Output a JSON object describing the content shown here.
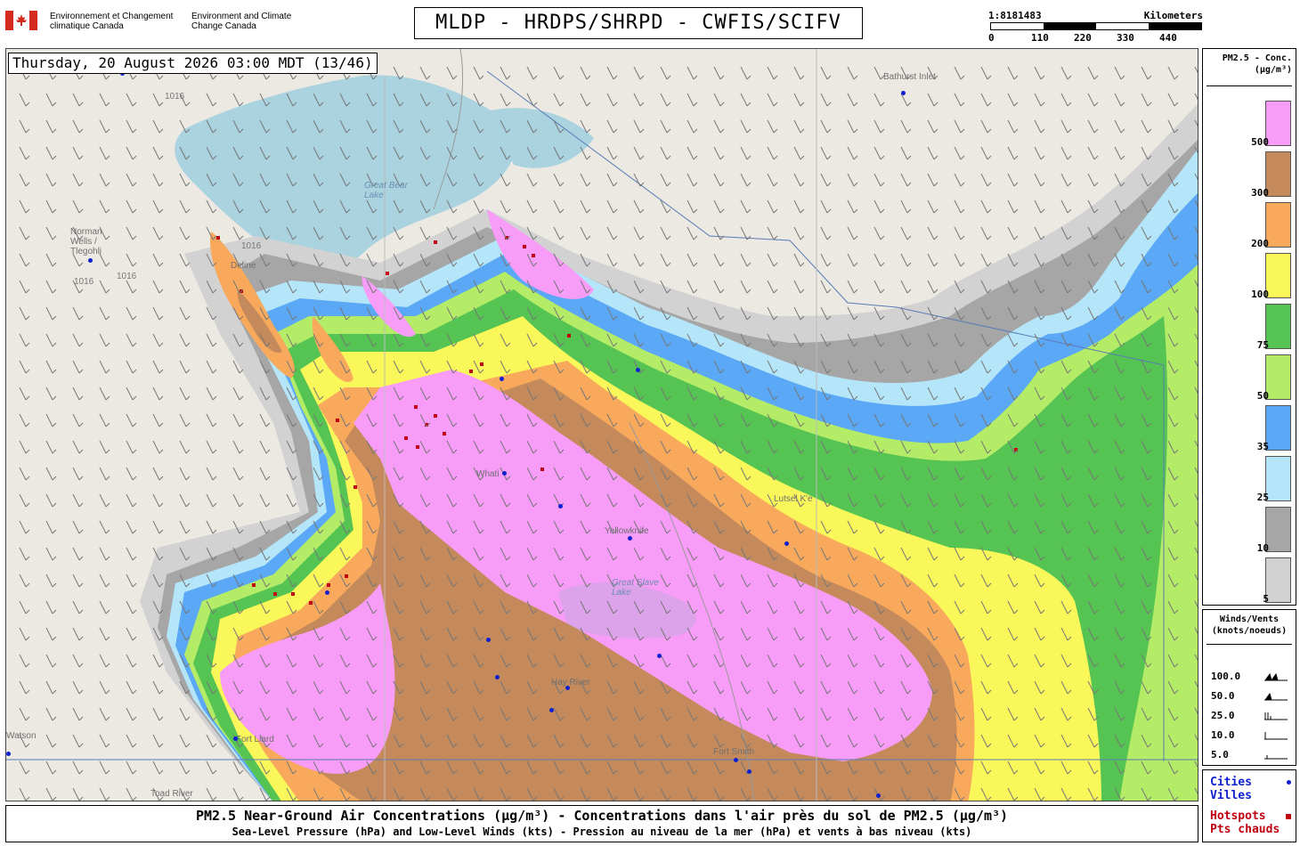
{
  "header": {
    "agency_fr": "Environnement et Changement climatique Canada",
    "agency_en": "Environment and Climate Change Canada",
    "title": "MLDP - HRDPS/SHRPD - CWFIS/SCIFV",
    "flag_color": "#d52b1e"
  },
  "scale": {
    "ratio": "1:8181483",
    "unit": "Kilometers",
    "ticks": [
      "0",
      "110",
      "220",
      "330",
      "440"
    ]
  },
  "map": {
    "timestamp": "Thursday, 20 August 2026 03:00 MDT (13/46)",
    "places": {
      "bathurst": "Bathurst Inlet",
      "great_bear": "Great Bear Lake",
      "norman_wells": "Norman Wells / Tlegohli",
      "deline": "Deline",
      "whati": "Whati",
      "yellowknife": "Yellowknife",
      "great_slave": "Great Slave Lake",
      "lutselke": "Lutsel K'e",
      "hay_river": "Hay River",
      "fort_liard": "Fort Liard",
      "fort_smith": "Fort Smith",
      "toad_river": "Toad River",
      "watson": "Watson"
    },
    "isobar_labels": [
      "1016",
      "1016",
      "1016",
      "1016",
      "1016"
    ]
  },
  "legend": {
    "concentration_title": "PM2.5 - Conc. (µg/m³)",
    "levels": [
      {
        "label": "500",
        "color": "#f79cf7"
      },
      {
        "label": "300",
        "color": "#c48a5c"
      },
      {
        "label": "200",
        "color": "#f8a95c"
      },
      {
        "label": "100",
        "color": "#f9f75a"
      },
      {
        "label": "75",
        "color": "#55c452"
      },
      {
        "label": "50",
        "color": "#b4ec67"
      },
      {
        "label": "35",
        "color": "#5aa8f6"
      },
      {
        "label": "25",
        "color": "#b5e5f8"
      },
      {
        "label": "10",
        "color": "#a6a6a6"
      },
      {
        "label": "5",
        "color": "#d2d2d2"
      }
    ],
    "wind_title": "Winds/Vents (knots/noeuds)",
    "wind_levels": [
      "100.0",
      "50.0",
      "25.0",
      "10.0",
      "5.0"
    ],
    "cities": "Cities",
    "villes": "Villes",
    "hotspots": "Hotspots",
    "pts_chauds": "Pts chauds",
    "city_color": "#1020d0",
    "hotspot_color": "#c00010"
  },
  "footer": {
    "title": "PM2.5 Near-Ground Air Concentrations (µg/m³) - Concentrations dans l'air près du sol de PM2.5 (µg/m³)",
    "subtitle": "Sea-Level Pressure (hPa) and Low-Level Winds (kts) - Pression au niveau de la mer (hPa) et vents à bas niveau (kts)"
  }
}
